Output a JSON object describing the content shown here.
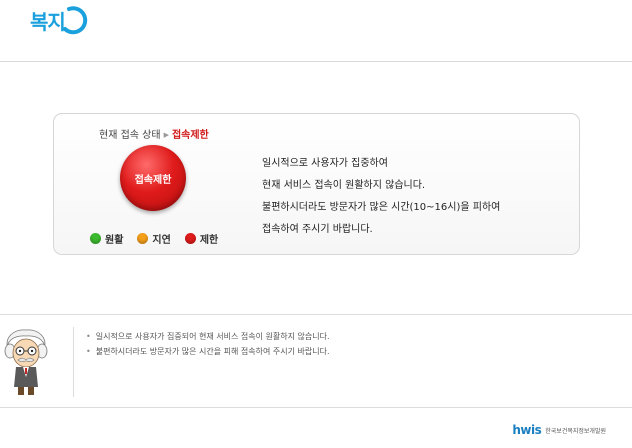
{
  "header": {
    "logo_text": "복지"
  },
  "status": {
    "label": "현재 접속 상태",
    "current": "접속제한",
    "button_label": "접속제한"
  },
  "legend": [
    {
      "label": "원활",
      "color": "#3dbb2f"
    },
    {
      "label": "지연",
      "color": "#f5a01a"
    },
    {
      "label": "제한",
      "color": "#e01b1b"
    }
  ],
  "message": {
    "line1": "일시적으로 사용자가 집중하여",
    "line2": "현재 서비스 접속이 원활하지 않습니다.",
    "line3": "불편하시더라도 방문자가 많은 시간(10~16시)을 피하여",
    "line4": "접속하여 주시기 바랍니다."
  },
  "notice": {
    "items": [
      "일시적으로 사용자가 집중되어 현재 서비스 접속이 원활하지 않습니다.",
      "불편하시더라도 방문자가 많은 시간을 피해 접속하여 주시기 바랍니다."
    ]
  },
  "footer": {
    "mark": "hwis",
    "org": "한국보건복지정보개발원"
  },
  "icons": {
    "logo": "welfare-logo-icon",
    "mascot": "professor-mascot-icon"
  }
}
